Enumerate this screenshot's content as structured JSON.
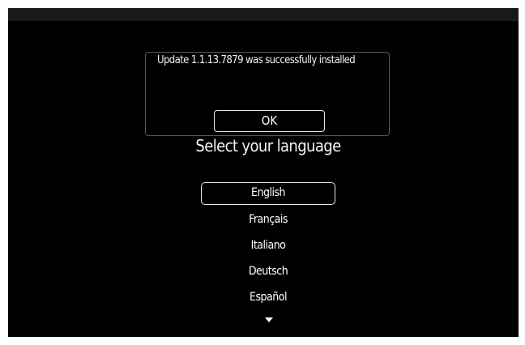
{
  "dialog": {
    "message": "Update 1.1.13.7879 was successfully installed",
    "ok_label": "OK"
  },
  "language_screen": {
    "title": "Select your language",
    "languages": [
      {
        "label": "English",
        "selected": true
      },
      {
        "label": "Français",
        "selected": false
      },
      {
        "label": "Italiano",
        "selected": false
      },
      {
        "label": "Deutsch",
        "selected": false
      },
      {
        "label": "Español",
        "selected": false
      }
    ],
    "more_indicator_icon": "triangle-down-icon"
  },
  "colors": {
    "background": "#000000",
    "top_bar": "#191919",
    "text": "#ffffff",
    "dialog_border": "#5a5a5a"
  }
}
